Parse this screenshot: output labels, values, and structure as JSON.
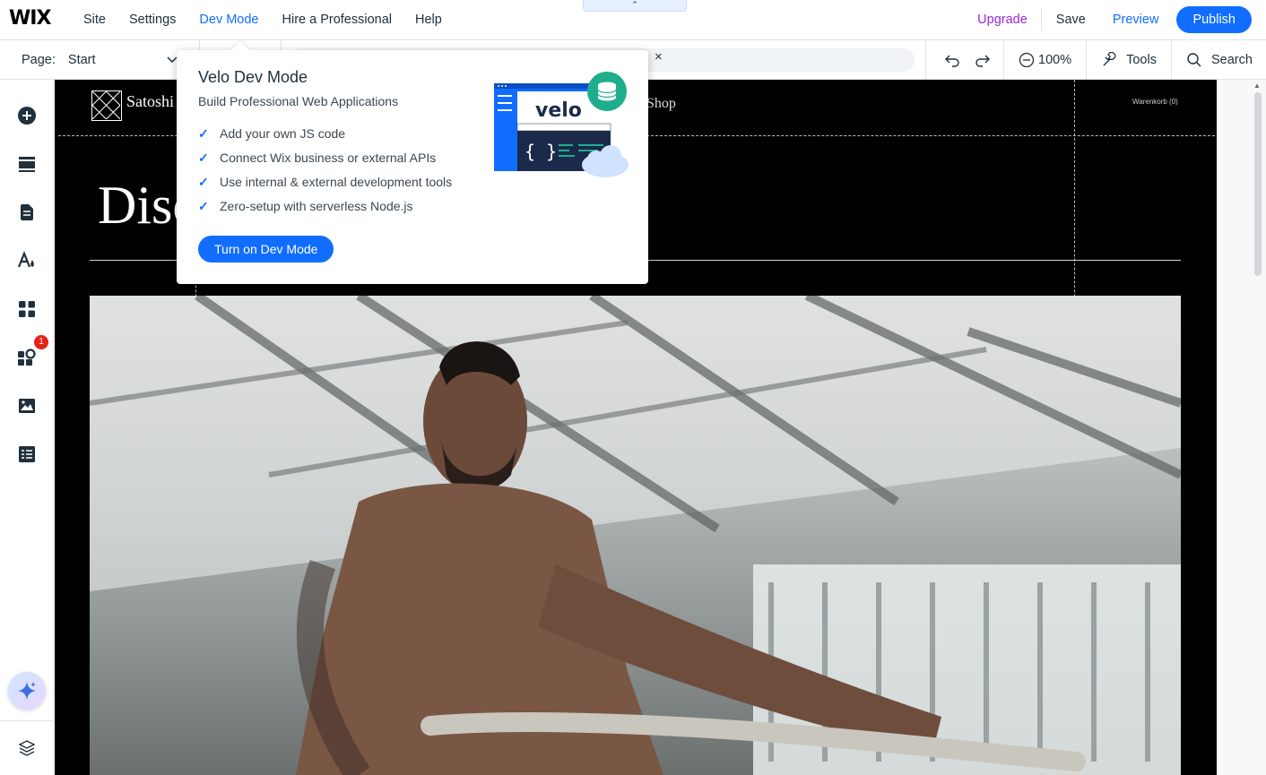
{
  "topbar": {
    "logo": "WIX",
    "menu": [
      "Site",
      "Settings",
      "Dev Mode",
      "Hire a Professional",
      "Help"
    ],
    "pulltab": "⌃",
    "upgrade": "Upgrade",
    "save": "Save",
    "preview": "Preview",
    "publish": "Publish"
  },
  "toolbar": {
    "page_label": "Page:",
    "page_value": "Start",
    "url_close": "×",
    "zoom": "100%",
    "tools": "Tools",
    "search": "Search"
  },
  "sidebar": {
    "apps_badge": "1"
  },
  "site": {
    "name": "Satoshi S",
    "shop": "Shop",
    "cart": "Warenkorb (0)",
    "headline": "Disc"
  },
  "popup": {
    "title": "Velo Dev Mode",
    "subtitle": "Build Professional Web Applications",
    "features": [
      "Add your own JS code",
      "Connect Wix business or external APIs",
      "Use internal & external development tools",
      "Zero-setup with serverless Node.js"
    ],
    "button": "Turn on Dev Mode",
    "art_logo": "velo",
    "art_code": "{ }"
  },
  "colors": {
    "accent": "#116dff",
    "upgrade": "#9a27d5",
    "velo_teal": "#1fae8c"
  }
}
